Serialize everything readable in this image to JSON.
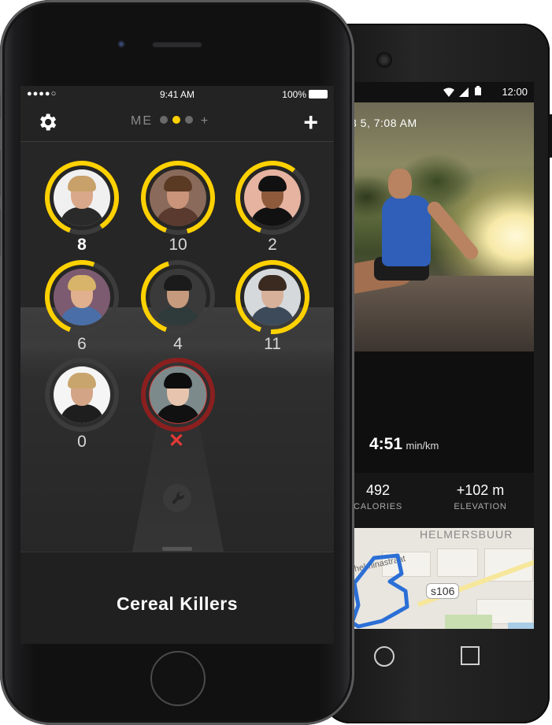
{
  "android": {
    "status": {
      "time": "12:00"
    },
    "photo_date": "3 5, 7:08 AM",
    "pace": {
      "value": "4:51",
      "unit": "min/km"
    },
    "stats": [
      {
        "value": "492",
        "label": "CALORIES"
      },
      {
        "value": "+102 m",
        "label": "ELEVATION"
      }
    ],
    "map": {
      "district": "HELMERSBUUR",
      "street": "lhelminastraat",
      "route_shield": "s106"
    }
  },
  "ios": {
    "status": {
      "signal": "●●●●○",
      "time": "9:41 AM",
      "battery": "100%"
    },
    "pager": {
      "label": "ME",
      "plus": "+"
    },
    "add_label": "+",
    "friends": [
      {
        "count": "8",
        "progress": 0.85
      },
      {
        "count": "10",
        "progress": 0.9
      },
      {
        "count": "2",
        "progress": 0.55
      },
      {
        "count": "6",
        "progress": 0.5
      },
      {
        "count": "4",
        "progress": 0.4
      },
      {
        "count": "11",
        "progress": 0.95
      },
      {
        "count": "0",
        "progress": 0.0
      },
      {
        "count": "",
        "progress": 0.0,
        "removed": true
      }
    ],
    "remove_mark": "✕",
    "group_name": "Cereal Killers"
  },
  "colors": {
    "accent": "#ffd100",
    "danger": "#e53935",
    "route": "#2b6fd6"
  }
}
